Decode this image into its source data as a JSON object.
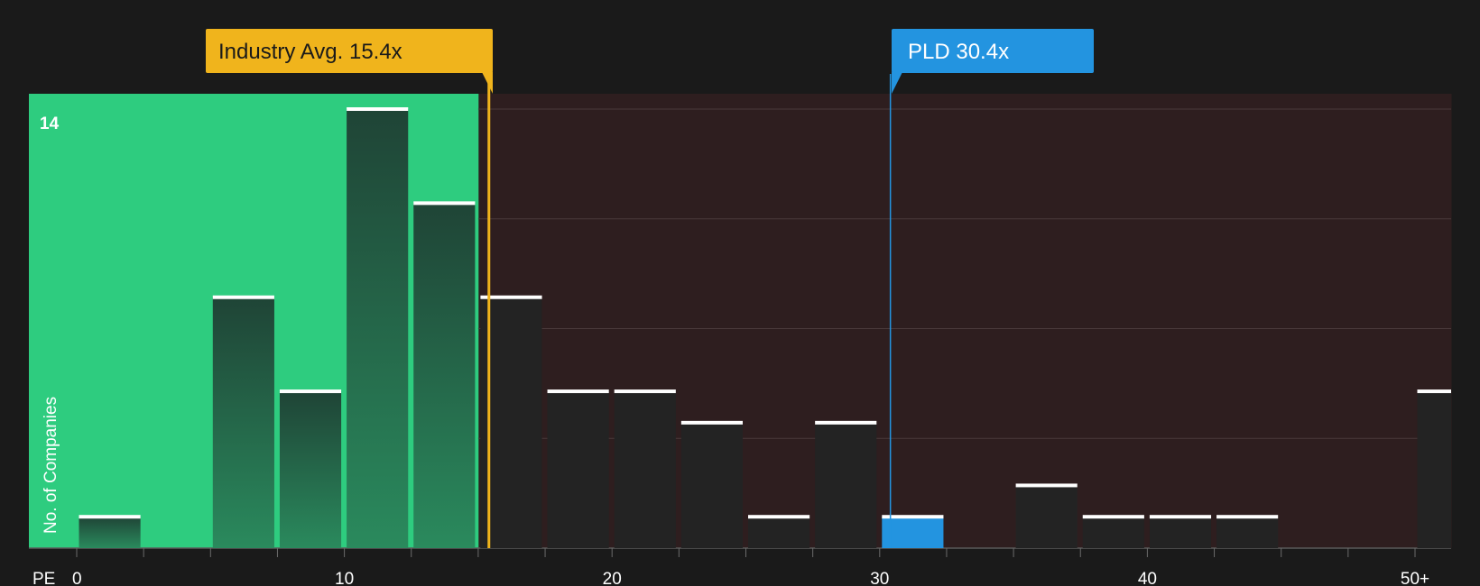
{
  "colors": {
    "background": "#1a1a1a",
    "below_avg_region": "#2ecc7f",
    "above_avg_region": "#2e1e1f",
    "industry_accent": "#f0b41c",
    "company_accent": "#2394e0",
    "bar_fill_dark": "#232323",
    "bar_cap": "#ffffff"
  },
  "callouts": {
    "industry": {
      "label": "Industry Avg. 15.4x",
      "value": 15.4
    },
    "company": {
      "label": "PLD 30.4x",
      "value": 30.4
    }
  },
  "chart_data": {
    "type": "bar",
    "subtype": "histogram",
    "xlabel": "PE",
    "ylabel": "No. of Companies",
    "x_ticks": [
      "0",
      "10",
      "20",
      "30",
      "40",
      "50+"
    ],
    "x_tick_values": [
      0,
      10,
      20,
      30,
      40,
      50
    ],
    "y_tick_labels": [
      "14"
    ],
    "y_tick_values": [
      14
    ],
    "ylim": [
      0,
      14.5
    ],
    "bin_width": 2.5,
    "bins": [
      {
        "start": 0,
        "count": 1
      },
      {
        "start": 2.5,
        "count": 0
      },
      {
        "start": 5,
        "count": 8
      },
      {
        "start": 7.5,
        "count": 5
      },
      {
        "start": 10,
        "count": 14
      },
      {
        "start": 12.5,
        "count": 11
      },
      {
        "start": 15,
        "count": 8
      },
      {
        "start": 17.5,
        "count": 5
      },
      {
        "start": 20,
        "count": 5
      },
      {
        "start": 22.5,
        "count": 4
      },
      {
        "start": 25,
        "count": 1
      },
      {
        "start": 27.5,
        "count": 4
      },
      {
        "start": 30,
        "count": 1,
        "highlight": true
      },
      {
        "start": 32.5,
        "count": 0
      },
      {
        "start": 35,
        "count": 2
      },
      {
        "start": 37.5,
        "count": 1
      },
      {
        "start": 40,
        "count": 1
      },
      {
        "start": 42.5,
        "count": 1
      },
      {
        "start": 45,
        "count": 0
      },
      {
        "start": 47.5,
        "count": 0
      },
      {
        "start": 50,
        "count": 5,
        "overflow": true
      }
    ],
    "industry_avg": 15.4,
    "company": {
      "name": "PLD",
      "value": 30.4
    },
    "grid": true
  }
}
